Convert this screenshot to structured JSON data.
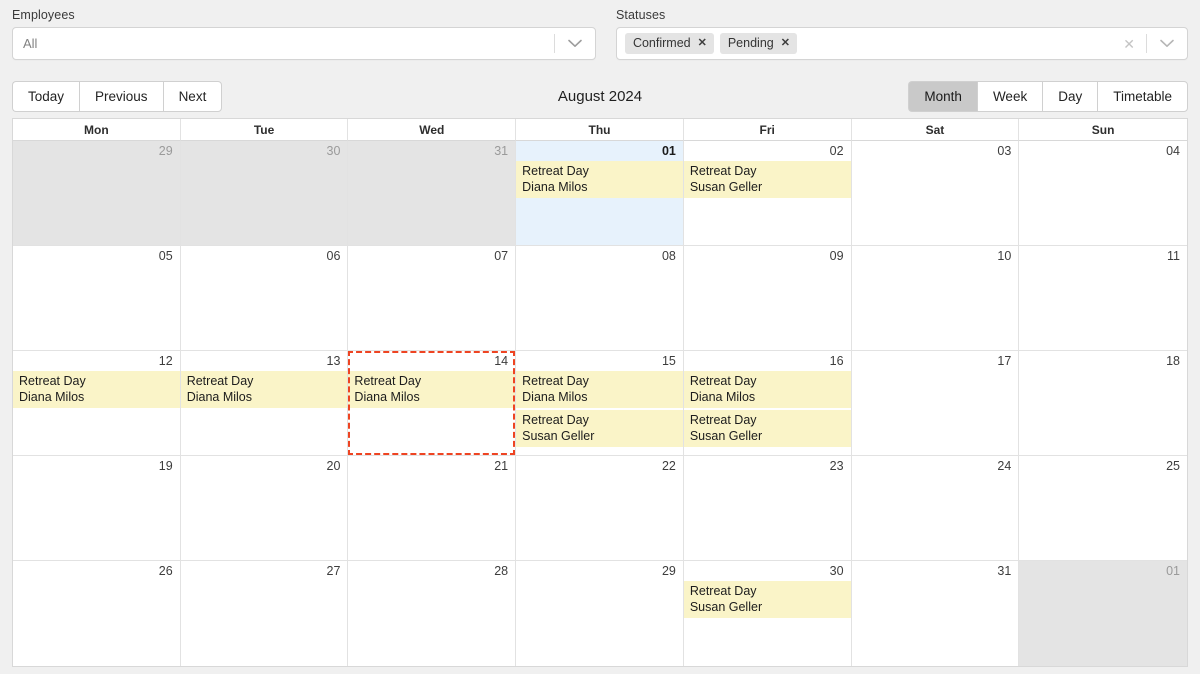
{
  "filters": {
    "employees": {
      "label": "Employees",
      "value": "All",
      "arrow_icon": "chevron-down-icon"
    },
    "statuses": {
      "label": "Statuses",
      "chips": [
        {
          "label": "Confirmed",
          "remove_icon": "x-icon"
        },
        {
          "label": "Pending",
          "remove_icon": "x-icon"
        }
      ],
      "clear_icon": "clear-x-icon",
      "arrow_icon": "chevron-down-icon"
    }
  },
  "toolbar": {
    "nav": [
      {
        "label": "Today",
        "active": false
      },
      {
        "label": "Previous",
        "active": false
      },
      {
        "label": "Next",
        "active": false
      }
    ],
    "title": "August 2024",
    "views": [
      {
        "label": "Month",
        "active": true
      },
      {
        "label": "Week",
        "active": false
      },
      {
        "label": "Day",
        "active": false
      },
      {
        "label": "Timetable",
        "active": false
      }
    ]
  },
  "calendar": {
    "weekdays": [
      "Mon",
      "Tue",
      "Wed",
      "Thu",
      "Fri",
      "Sat",
      "Sun"
    ],
    "weeks": [
      [
        {
          "day": "29",
          "other_month": true,
          "today": false,
          "events": []
        },
        {
          "day": "30",
          "other_month": true,
          "today": false,
          "events": []
        },
        {
          "day": "31",
          "other_month": true,
          "today": false,
          "events": []
        },
        {
          "day": "01",
          "other_month": false,
          "today": true,
          "events": [
            {
              "title": "Retreat Day",
              "person": "Diana Milos"
            }
          ]
        },
        {
          "day": "02",
          "other_month": false,
          "today": false,
          "events": [
            {
              "title": "Retreat Day",
              "person": "Susan Geller"
            }
          ]
        },
        {
          "day": "03",
          "other_month": false,
          "today": false,
          "events": []
        },
        {
          "day": "04",
          "other_month": false,
          "today": false,
          "events": []
        }
      ],
      [
        {
          "day": "05",
          "other_month": false,
          "today": false,
          "events": []
        },
        {
          "day": "06",
          "other_month": false,
          "today": false,
          "events": []
        },
        {
          "day": "07",
          "other_month": false,
          "today": false,
          "events": []
        },
        {
          "day": "08",
          "other_month": false,
          "today": false,
          "events": []
        },
        {
          "day": "09",
          "other_month": false,
          "today": false,
          "events": []
        },
        {
          "day": "10",
          "other_month": false,
          "today": false,
          "events": []
        },
        {
          "day": "11",
          "other_month": false,
          "today": false,
          "events": []
        }
      ],
      [
        {
          "day": "12",
          "other_month": false,
          "today": false,
          "events": [
            {
              "title": "Retreat Day",
              "person": "Diana Milos"
            }
          ]
        },
        {
          "day": "13",
          "other_month": false,
          "today": false,
          "events": [
            {
              "title": "Retreat Day",
              "person": "Diana Milos"
            }
          ]
        },
        {
          "day": "14",
          "other_month": false,
          "today": false,
          "selected": true,
          "events": [
            {
              "title": "Retreat Day",
              "person": "Diana Milos"
            }
          ]
        },
        {
          "day": "15",
          "other_month": false,
          "today": false,
          "events": [
            {
              "title": "Retreat Day",
              "person": "Diana Milos"
            },
            {
              "title": "Retreat Day",
              "person": "Susan Geller"
            }
          ]
        },
        {
          "day": "16",
          "other_month": false,
          "today": false,
          "events": [
            {
              "title": "Retreat Day",
              "person": "Diana Milos"
            },
            {
              "title": "Retreat Day",
              "person": "Susan Geller"
            }
          ]
        },
        {
          "day": "17",
          "other_month": false,
          "today": false,
          "events": []
        },
        {
          "day": "18",
          "other_month": false,
          "today": false,
          "events": []
        }
      ],
      [
        {
          "day": "19",
          "other_month": false,
          "today": false,
          "events": []
        },
        {
          "day": "20",
          "other_month": false,
          "today": false,
          "events": []
        },
        {
          "day": "21",
          "other_month": false,
          "today": false,
          "events": []
        },
        {
          "day": "22",
          "other_month": false,
          "today": false,
          "events": []
        },
        {
          "day": "23",
          "other_month": false,
          "today": false,
          "events": []
        },
        {
          "day": "24",
          "other_month": false,
          "today": false,
          "events": []
        },
        {
          "day": "25",
          "other_month": false,
          "today": false,
          "events": []
        }
      ],
      [
        {
          "day": "26",
          "other_month": false,
          "today": false,
          "events": []
        },
        {
          "day": "27",
          "other_month": false,
          "today": false,
          "events": []
        },
        {
          "day": "28",
          "other_month": false,
          "today": false,
          "events": []
        },
        {
          "day": "29",
          "other_month": false,
          "today": false,
          "events": []
        },
        {
          "day": "30",
          "other_month": false,
          "today": false,
          "events": [
            {
              "title": "Retreat Day",
              "person": "Susan Geller"
            }
          ]
        },
        {
          "day": "31",
          "other_month": false,
          "today": false,
          "events": []
        },
        {
          "day": "01",
          "other_month": true,
          "today": false,
          "events": []
        }
      ]
    ]
  },
  "colors": {
    "event_bg": "#faf4c8",
    "today_bg": "#e7f2fc",
    "other_month_bg": "#e4e4e4",
    "selection_border": "#ee4422",
    "page_bg": "#f0f0f0",
    "active_button_bg": "#c9c9c9"
  }
}
